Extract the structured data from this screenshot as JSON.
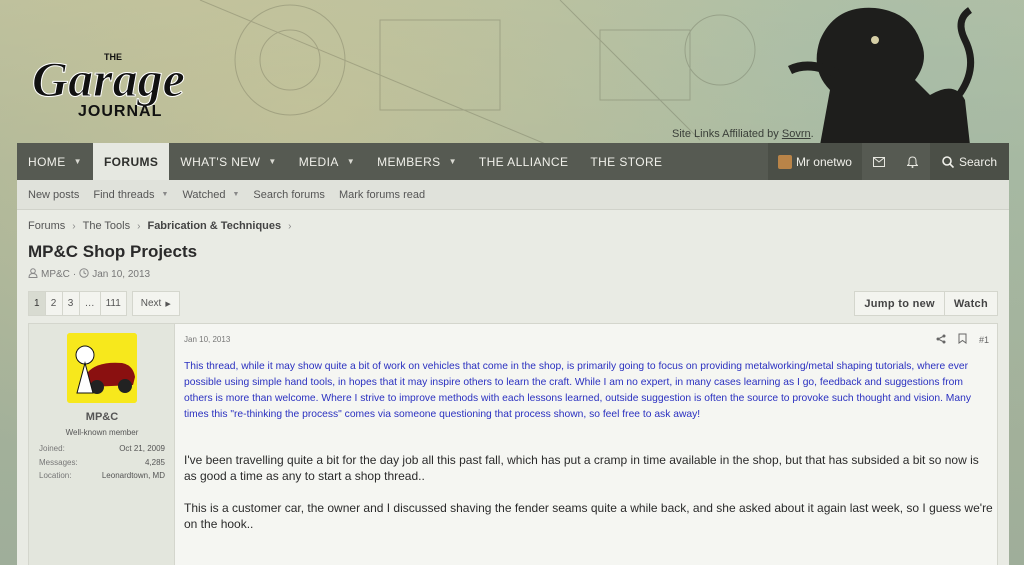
{
  "header": {
    "logo_top": "THE",
    "logo_main": "Garage",
    "logo_bottom": "JOURNAL",
    "affiliation_prefix": "Site Links Affiliated by",
    "affiliation_link": "Sovrn"
  },
  "nav": {
    "items": [
      {
        "label": "HOME",
        "caret": true
      },
      {
        "label": "FORUMS",
        "caret": false,
        "active": true
      },
      {
        "label": "WHAT'S NEW",
        "caret": true
      },
      {
        "label": "MEDIA",
        "caret": true
      },
      {
        "label": "MEMBERS",
        "caret": true
      },
      {
        "label": "THE ALLIANCE",
        "caret": false
      },
      {
        "label": "THE STORE",
        "caret": false
      }
    ],
    "user": "Mr onetwo",
    "search": "Search"
  },
  "subnav": {
    "items": [
      "New posts",
      "Find threads",
      "Watched",
      "Search forums",
      "Mark forums read"
    ]
  },
  "breadcrumb": [
    "Forums",
    "The Tools",
    "Fabrication & Techniques"
  ],
  "thread": {
    "title": "MP&C Shop Projects",
    "author": "MP&C",
    "date": "Jan 10, 2013"
  },
  "pager": {
    "pages": [
      "1",
      "2",
      "3",
      "…",
      "111"
    ],
    "current": "1",
    "next": "Next"
  },
  "actions": {
    "jump": "Jump to new",
    "watch": "Watch"
  },
  "post": {
    "user": {
      "name": "MP&C",
      "title": "Well-known member",
      "stats": [
        {
          "label": "Joined:",
          "value": "Oct 21, 2009"
        },
        {
          "label": "Messages:",
          "value": "4,285"
        },
        {
          "label": "Location:",
          "value": "Leonardtown, MD"
        }
      ]
    },
    "date": "Jan 10, 2013",
    "number": "#1",
    "intro": "This thread, while it may show quite a bit of work on vehicles that come in the shop, is primarily going to focus on providing metalworking/metal shaping tutorials, where ever possible using simple hand tools, in hopes that it may inspire others to learn the craft. While I am no expert, in many cases learning as I go, feedback and suggestions from others is more than welcome. Where I strive to improve methods with each lessons learned, outside suggestion is often the source to provoke such thought and vision. Many times this \"re-thinking the process\" comes via someone questioning that process shown, so feel free to ask away!",
    "para1": "I've been travelling quite a bit for the day job all this past fall, which has put a cramp in time available in the shop, but that has subsided a bit so now is as good a time as any to start a shop thread..",
    "para2": "This is a customer car, the owner and I discussed shaving the fender seams quite a while back, and she asked about it again last week, so I guess we're on the hook.."
  },
  "colors": {
    "navbar": "#565a52",
    "intro_text": "#2a30c0",
    "avatar_bg": "#f7e81c"
  }
}
